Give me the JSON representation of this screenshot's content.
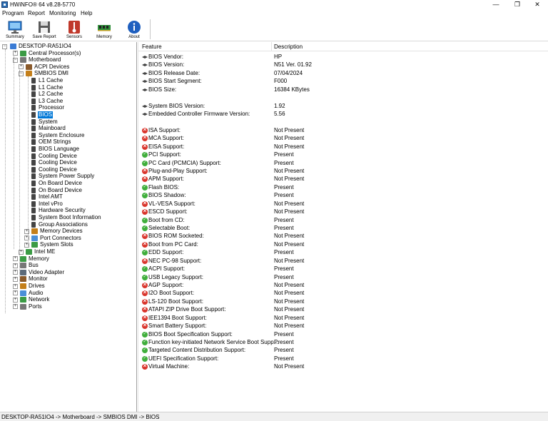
{
  "window": {
    "title": "HWiNFO® 64 v8.28-5770",
    "min": "—",
    "max": "❐",
    "close": "✕"
  },
  "menu": [
    "Program",
    "Report",
    "Monitoring",
    "Help"
  ],
  "toolbar": [
    {
      "label": "Summary",
      "icon": "monitor-icon"
    },
    {
      "label": "Save Report",
      "icon": "floppy-icon"
    },
    {
      "label": "Sensors",
      "icon": "thermometer-icon"
    },
    {
      "label": "Memory",
      "icon": "ram-icon"
    },
    {
      "label": "About",
      "icon": "info-icon"
    }
  ],
  "tree": {
    "root": "DESKTOP-RA51IO4",
    "items": [
      {
        "label": "Central Processor(s)",
        "level": 1,
        "exp": "+"
      },
      {
        "label": "Motherboard",
        "level": 1,
        "exp": "-"
      },
      {
        "label": "ACPI Devices",
        "level": 2,
        "exp": "+"
      },
      {
        "label": "SMBIOS DMI",
        "level": 2,
        "exp": "-"
      },
      {
        "label": "L1 Cache",
        "level": 3
      },
      {
        "label": "L1 Cache",
        "level": 3
      },
      {
        "label": "L2 Cache",
        "level": 3
      },
      {
        "label": "L3 Cache",
        "level": 3
      },
      {
        "label": "Processor",
        "level": 3
      },
      {
        "label": "BIOS",
        "level": 3,
        "selected": true
      },
      {
        "label": "System",
        "level": 3
      },
      {
        "label": "Mainboard",
        "level": 3
      },
      {
        "label": "System Enclosure",
        "level": 3
      },
      {
        "label": "OEM Strings",
        "level": 3
      },
      {
        "label": "BIOS Language",
        "level": 3
      },
      {
        "label": "Cooling Device",
        "level": 3
      },
      {
        "label": "Cooling Device",
        "level": 3
      },
      {
        "label": "Cooling Device",
        "level": 3
      },
      {
        "label": "System Power Supply",
        "level": 3
      },
      {
        "label": "On Board Device",
        "level": 3
      },
      {
        "label": "On Board Device",
        "level": 3
      },
      {
        "label": "Intel AMT",
        "level": 3
      },
      {
        "label": "Intel vPro",
        "level": 3
      },
      {
        "label": "Hardware Security",
        "level": 3
      },
      {
        "label": "System Boot Information",
        "level": 3
      },
      {
        "label": "Group Associations",
        "level": 3
      },
      {
        "label": "Memory Devices",
        "level": 3,
        "exp": "+"
      },
      {
        "label": "Port Connectors",
        "level": 3,
        "exp": "+"
      },
      {
        "label": "System Slots",
        "level": 3,
        "exp": "+"
      },
      {
        "label": "Intel ME",
        "level": 2,
        "exp": "+"
      },
      {
        "label": "Memory",
        "level": 1,
        "exp": "+"
      },
      {
        "label": "Bus",
        "level": 1,
        "exp": "+"
      },
      {
        "label": "Video Adapter",
        "level": 1,
        "exp": "+"
      },
      {
        "label": "Monitor",
        "level": 1,
        "exp": "+"
      },
      {
        "label": "Drives",
        "level": 1,
        "exp": "+"
      },
      {
        "label": "Audio",
        "level": 1,
        "exp": "+"
      },
      {
        "label": "Network",
        "level": 1,
        "exp": "+"
      },
      {
        "label": "Ports",
        "level": 1,
        "exp": "+"
      }
    ]
  },
  "details": {
    "headers": {
      "feature": "Feature",
      "description": "Description"
    },
    "rows": [
      {
        "feature": "BIOS Vendor:",
        "value": "HP",
        "icon": "bios"
      },
      {
        "feature": "BIOS Version:",
        "value": "N51 Ver. 01.92",
        "icon": "bios"
      },
      {
        "feature": "BIOS Release Date:",
        "value": "07/04/2024",
        "icon": "bios"
      },
      {
        "feature": "BIOS Start Segment:",
        "value": "F000",
        "icon": "bios"
      },
      {
        "feature": "BIOS Size:",
        "value": "16384 KBytes",
        "icon": "bios"
      },
      {
        "blank": true
      },
      {
        "feature": "System BIOS Version:",
        "value": "1.92",
        "icon": "bios"
      },
      {
        "feature": "Embedded Controller Firmware Version:",
        "value": "5.56",
        "icon": "bios"
      },
      {
        "blank": true
      },
      {
        "feature": "ISA Support:",
        "value": "Not Present",
        "icon": "np"
      },
      {
        "feature": "MCA Support:",
        "value": "Not Present",
        "icon": "np"
      },
      {
        "feature": "EISA Support:",
        "value": "Not Present",
        "icon": "np"
      },
      {
        "feature": "PCI Support:",
        "value": "Present",
        "icon": "pr"
      },
      {
        "feature": "PC Card (PCMCIA) Support:",
        "value": "Present",
        "icon": "pr"
      },
      {
        "feature": "Plug-and-Play Support:",
        "value": "Not Present",
        "icon": "np"
      },
      {
        "feature": "APM Support:",
        "value": "Not Present",
        "icon": "np"
      },
      {
        "feature": "Flash BIOS:",
        "value": "Present",
        "icon": "pr"
      },
      {
        "feature": "BIOS Shadow:",
        "value": "Present",
        "icon": "pr"
      },
      {
        "feature": "VL-VESA Support:",
        "value": "Not Present",
        "icon": "np"
      },
      {
        "feature": "ESCD Support:",
        "value": "Not Present",
        "icon": "np"
      },
      {
        "feature": "Boot from CD:",
        "value": "Present",
        "icon": "pr"
      },
      {
        "feature": "Selectable Boot:",
        "value": "Present",
        "icon": "pr"
      },
      {
        "feature": "BIOS ROM Socketed:",
        "value": "Not Present",
        "icon": "np"
      },
      {
        "feature": "Boot from PC Card:",
        "value": "Not Present",
        "icon": "np"
      },
      {
        "feature": "EDD Support:",
        "value": "Present",
        "icon": "pr"
      },
      {
        "feature": "NEC PC-98 Support:",
        "value": "Not Present",
        "icon": "np"
      },
      {
        "feature": "ACPI Support:",
        "value": "Present",
        "icon": "pr"
      },
      {
        "feature": "USB Legacy Support:",
        "value": "Present",
        "icon": "pr"
      },
      {
        "feature": "AGP Support:",
        "value": "Not Present",
        "icon": "np"
      },
      {
        "feature": "I2O Boot Support:",
        "value": "Not Present",
        "icon": "np"
      },
      {
        "feature": "LS-120 Boot Support:",
        "value": "Not Present",
        "icon": "np"
      },
      {
        "feature": "ATAPI ZIP Drive Boot Support:",
        "value": "Not Present",
        "icon": "np"
      },
      {
        "feature": "IEE1394 Boot Support:",
        "value": "Not Present",
        "icon": "np"
      },
      {
        "feature": "Smart Battery Support:",
        "value": "Not Present",
        "icon": "np"
      },
      {
        "feature": "BIOS Boot Specification Support:",
        "value": "Present",
        "icon": "pr"
      },
      {
        "feature": "Function key-initiated Network Service Boot Supp...",
        "value": "Present",
        "icon": "pr"
      },
      {
        "feature": "Targeted Content Distribution Support:",
        "value": "Present",
        "icon": "pr"
      },
      {
        "feature": "UEFI Specification Support:",
        "value": "Present",
        "icon": "pr"
      },
      {
        "feature": "Virtual Machine:",
        "value": "Not Present",
        "icon": "np"
      }
    ]
  },
  "status": "DESKTOP-RA51IO4 -> Motherboard -> SMBIOS DMI -> BIOS",
  "colors": {
    "selection": "#0078d7",
    "present": "#3fae3b",
    "not_present": "#d9342b"
  }
}
